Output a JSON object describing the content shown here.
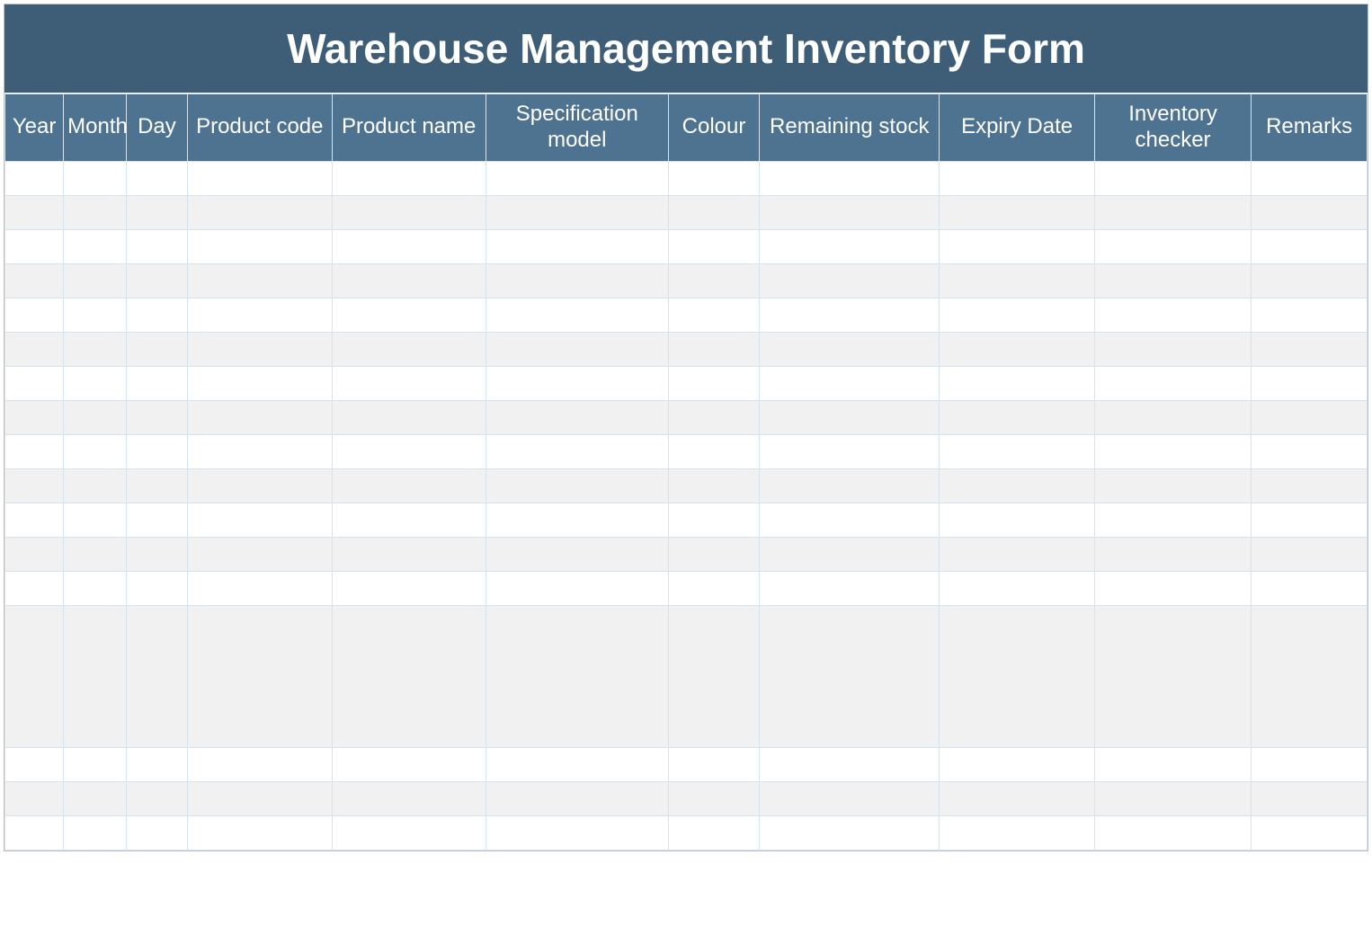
{
  "title": "Warehouse Management Inventory Form",
  "columns": {
    "year": "Year",
    "month": "Month",
    "day": "Day",
    "product_code": "Product code",
    "product_name": "Product name",
    "specification_model": "Specification model",
    "colour": "Colour",
    "remaining_stock": "Remaining stock",
    "expiry_date": "Expiry Date",
    "inventory_checker": "Inventory checker",
    "remarks": "Remarks"
  },
  "rows": [
    {
      "year": "",
      "month": "",
      "day": "",
      "product_code": "",
      "product_name": "",
      "specification_model": "",
      "colour": "",
      "remaining_stock": "",
      "expiry_date": "",
      "inventory_checker": "",
      "remarks": ""
    },
    {
      "year": "",
      "month": "",
      "day": "",
      "product_code": "",
      "product_name": "",
      "specification_model": "",
      "colour": "",
      "remaining_stock": "",
      "expiry_date": "",
      "inventory_checker": "",
      "remarks": ""
    },
    {
      "year": "",
      "month": "",
      "day": "",
      "product_code": "",
      "product_name": "",
      "specification_model": "",
      "colour": "",
      "remaining_stock": "",
      "expiry_date": "",
      "inventory_checker": "",
      "remarks": ""
    },
    {
      "year": "",
      "month": "",
      "day": "",
      "product_code": "",
      "product_name": "",
      "specification_model": "",
      "colour": "",
      "remaining_stock": "",
      "expiry_date": "",
      "inventory_checker": "",
      "remarks": ""
    },
    {
      "year": "",
      "month": "",
      "day": "",
      "product_code": "",
      "product_name": "",
      "specification_model": "",
      "colour": "",
      "remaining_stock": "",
      "expiry_date": "",
      "inventory_checker": "",
      "remarks": ""
    },
    {
      "year": "",
      "month": "",
      "day": "",
      "product_code": "",
      "product_name": "",
      "specification_model": "",
      "colour": "",
      "remaining_stock": "",
      "expiry_date": "",
      "inventory_checker": "",
      "remarks": ""
    },
    {
      "year": "",
      "month": "",
      "day": "",
      "product_code": "",
      "product_name": "",
      "specification_model": "",
      "colour": "",
      "remaining_stock": "",
      "expiry_date": "",
      "inventory_checker": "",
      "remarks": ""
    },
    {
      "year": "",
      "month": "",
      "day": "",
      "product_code": "",
      "product_name": "",
      "specification_model": "",
      "colour": "",
      "remaining_stock": "",
      "expiry_date": "",
      "inventory_checker": "",
      "remarks": ""
    },
    {
      "year": "",
      "month": "",
      "day": "",
      "product_code": "",
      "product_name": "",
      "specification_model": "",
      "colour": "",
      "remaining_stock": "",
      "expiry_date": "",
      "inventory_checker": "",
      "remarks": ""
    },
    {
      "year": "",
      "month": "",
      "day": "",
      "product_code": "",
      "product_name": "",
      "specification_model": "",
      "colour": "",
      "remaining_stock": "",
      "expiry_date": "",
      "inventory_checker": "",
      "remarks": ""
    },
    {
      "year": "",
      "month": "",
      "day": "",
      "product_code": "",
      "product_name": "",
      "specification_model": "",
      "colour": "",
      "remaining_stock": "",
      "expiry_date": "",
      "inventory_checker": "",
      "remarks": ""
    },
    {
      "year": "",
      "month": "",
      "day": "",
      "product_code": "",
      "product_name": "",
      "specification_model": "",
      "colour": "",
      "remaining_stock": "",
      "expiry_date": "",
      "inventory_checker": "",
      "remarks": ""
    },
    {
      "year": "",
      "month": "",
      "day": "",
      "product_code": "",
      "product_name": "",
      "specification_model": "",
      "colour": "",
      "remaining_stock": "",
      "expiry_date": "",
      "inventory_checker": "",
      "remarks": ""
    },
    {
      "year": "",
      "month": "",
      "day": "",
      "product_code": "",
      "product_name": "",
      "specification_model": "",
      "colour": "",
      "remaining_stock": "",
      "expiry_date": "",
      "inventory_checker": "",
      "remarks": ""
    },
    {
      "year": "",
      "month": "",
      "day": "",
      "product_code": "",
      "product_name": "",
      "specification_model": "",
      "colour": "",
      "remaining_stock": "",
      "expiry_date": "",
      "inventory_checker": "",
      "remarks": ""
    },
    {
      "year": "",
      "month": "",
      "day": "",
      "product_code": "",
      "product_name": "",
      "specification_model": "",
      "colour": "",
      "remaining_stock": "",
      "expiry_date": "",
      "inventory_checker": "",
      "remarks": ""
    },
    {
      "year": "",
      "month": "",
      "day": "",
      "product_code": "",
      "product_name": "",
      "specification_model": "",
      "colour": "",
      "remaining_stock": "",
      "expiry_date": "",
      "inventory_checker": "",
      "remarks": ""
    }
  ],
  "big_row_index": 13
}
